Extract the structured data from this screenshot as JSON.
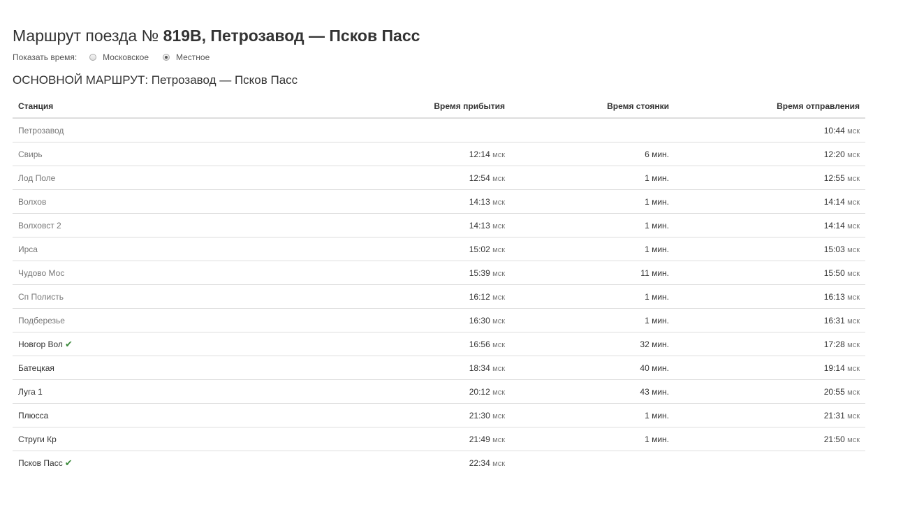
{
  "page": {
    "title_prefix": "Маршрут поезда № ",
    "title_bold": "819В, Петрозавод — Псков Пасс",
    "subtitle": "ОСНОВНОЙ МАРШРУТ: Петрозавод — Псков Пасс"
  },
  "time_mode": {
    "label": "Показать время:",
    "options": [
      {
        "label": "Московское",
        "selected": false
      },
      {
        "label": "Местное",
        "selected": true
      }
    ]
  },
  "table": {
    "headers": {
      "station": "Станция",
      "arrival": "Время прибытия",
      "stop": "Время стоянки",
      "departure": "Время отправления"
    },
    "time_unit": "мск",
    "rows": [
      {
        "station": "Петрозавод",
        "arrival": "",
        "stop": "",
        "departure": "10:44",
        "muted": true,
        "check": false
      },
      {
        "station": "Свирь",
        "arrival": "12:14",
        "stop": "6 мин.",
        "departure": "12:20",
        "muted": true,
        "check": false
      },
      {
        "station": "Лод Поле",
        "arrival": "12:54",
        "stop": "1 мин.",
        "departure": "12:55",
        "muted": true,
        "check": false
      },
      {
        "station": "Волхов",
        "arrival": "14:13",
        "stop": "1 мин.",
        "departure": "14:14",
        "muted": true,
        "check": false
      },
      {
        "station": "Волховст 2",
        "arrival": "14:13",
        "stop": "1 мин.",
        "departure": "14:14",
        "muted": true,
        "check": false
      },
      {
        "station": "Ирса",
        "arrival": "15:02",
        "stop": "1 мин.",
        "departure": "15:03",
        "muted": true,
        "check": false
      },
      {
        "station": "Чудово Мос",
        "arrival": "15:39",
        "stop": "11 мин.",
        "departure": "15:50",
        "muted": true,
        "check": false
      },
      {
        "station": "Сп Полисть",
        "arrival": "16:12",
        "stop": "1 мин.",
        "departure": "16:13",
        "muted": true,
        "check": false
      },
      {
        "station": "Подберезье",
        "arrival": "16:30",
        "stop": "1 мин.",
        "departure": "16:31",
        "muted": true,
        "check": false
      },
      {
        "station": "Новгор Вол",
        "arrival": "16:56",
        "stop": "32 мин.",
        "departure": "17:28",
        "muted": false,
        "check": true
      },
      {
        "station": "Батецкая",
        "arrival": "18:34",
        "stop": "40 мин.",
        "departure": "19:14",
        "muted": false,
        "check": false
      },
      {
        "station": "Луга 1",
        "arrival": "20:12",
        "stop": "43 мин.",
        "departure": "20:55",
        "muted": false,
        "check": false
      },
      {
        "station": "Плюсса",
        "arrival": "21:30",
        "stop": "1 мин.",
        "departure": "21:31",
        "muted": false,
        "check": false
      },
      {
        "station": "Струги Кр",
        "arrival": "21:49",
        "stop": "1 мин.",
        "departure": "21:50",
        "muted": false,
        "check": false
      },
      {
        "station": "Псков Пасс",
        "arrival": "22:34",
        "stop": "",
        "departure": "",
        "muted": false,
        "check": true
      }
    ]
  },
  "icons": {
    "check": "checkmark-icon",
    "check_color": "#3d8b3d"
  }
}
